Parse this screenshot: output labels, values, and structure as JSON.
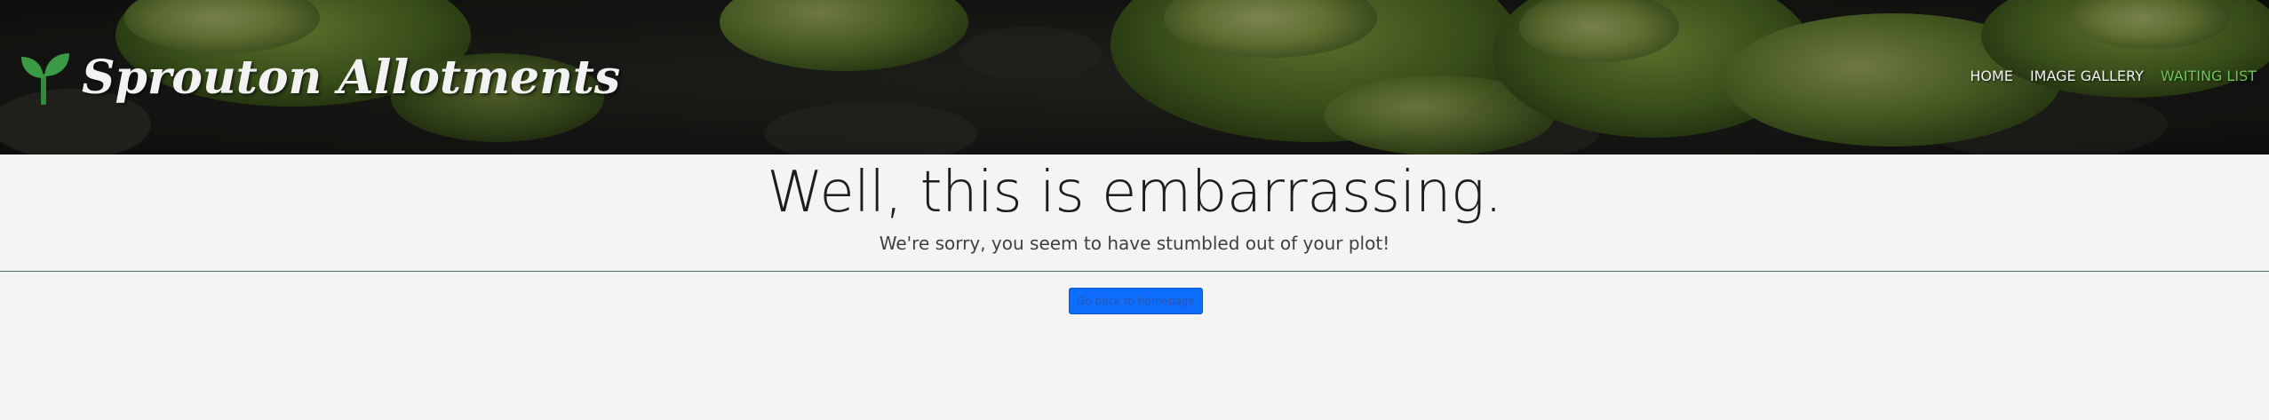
{
  "header": {
    "brand_name": "Sprouton Allotments",
    "brand_icon": "sprout-icon",
    "nav": [
      {
        "label": "HOME",
        "active": false
      },
      {
        "label": "IMAGE GALLERY",
        "active": false
      },
      {
        "label": "WAITING LIST",
        "active": true
      }
    ]
  },
  "main": {
    "heading": "Well, this is embarrassing.",
    "message": "We're sorry, you seem to have stumbled out of your plot!",
    "button_label": "Go back to homepage"
  },
  "colors": {
    "accent_green": "#6ec35a",
    "button_blue": "#0d6efd",
    "content_background": "#f4f4f4",
    "divider": "#4f6e68"
  }
}
